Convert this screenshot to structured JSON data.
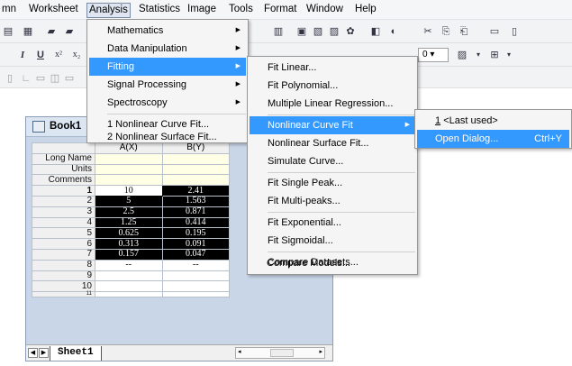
{
  "menubar": {
    "items": [
      "mn",
      "Worksheet",
      "Analysis",
      "Statistics",
      "Image",
      "Tools",
      "Format",
      "Window",
      "Help"
    ]
  },
  "toolbar": {
    "font_value": "0"
  },
  "workbook": {
    "title": "Book1",
    "col_a": "A(X)",
    "col_b": "B(Y)",
    "meta_rows": [
      "Long Name",
      "Units",
      "Comments"
    ],
    "rows": [
      {
        "n": "1",
        "a": "10",
        "b": "2.41"
      },
      {
        "n": "2",
        "a": "5",
        "b": "1.563"
      },
      {
        "n": "3",
        "a": "2.5",
        "b": "0.871"
      },
      {
        "n": "4",
        "a": "1.25",
        "b": "0.414"
      },
      {
        "n": "5",
        "a": "0.625",
        "b": "0.195"
      },
      {
        "n": "6",
        "a": "0.313",
        "b": "0.091"
      },
      {
        "n": "7",
        "a": "0.157",
        "b": "0.047"
      },
      {
        "n": "8",
        "a": "--",
        "b": "--"
      },
      {
        "n": "9",
        "a": "",
        "b": ""
      },
      {
        "n": "10",
        "a": "",
        "b": ""
      },
      {
        "n": "11",
        "a": "",
        "b": ""
      }
    ],
    "sheet_tab": "Sheet1"
  },
  "analysis_menu": {
    "items": [
      "Mathematics",
      "Data Manipulation",
      "Fitting",
      "Signal Processing",
      "Spectroscopy",
      "1 Nonlinear Curve Fit...",
      "2 Nonlinear Surface Fit..."
    ]
  },
  "fitting_menu": {
    "items": [
      "Fit Linear...",
      "Fit Polynomial...",
      "Multiple Linear Regression...",
      "Nonlinear Curve Fit",
      "Nonlinear Surface Fit...",
      "Simulate Curve...",
      "Fit Single Peak...",
      "Fit Multi-peaks...",
      "Fit Exponential...",
      "Fit Sigmoidal...",
      "Compare Datasets...",
      "Compare Models..."
    ]
  },
  "nlfit_menu": {
    "last_used": "<Last used>",
    "last_used_num": "1",
    "open_dialog": "Open Dialog...",
    "shortcut": "Ctrl+Y"
  },
  "colors": {
    "highlight": "#3399ff",
    "selection": "#000000"
  }
}
